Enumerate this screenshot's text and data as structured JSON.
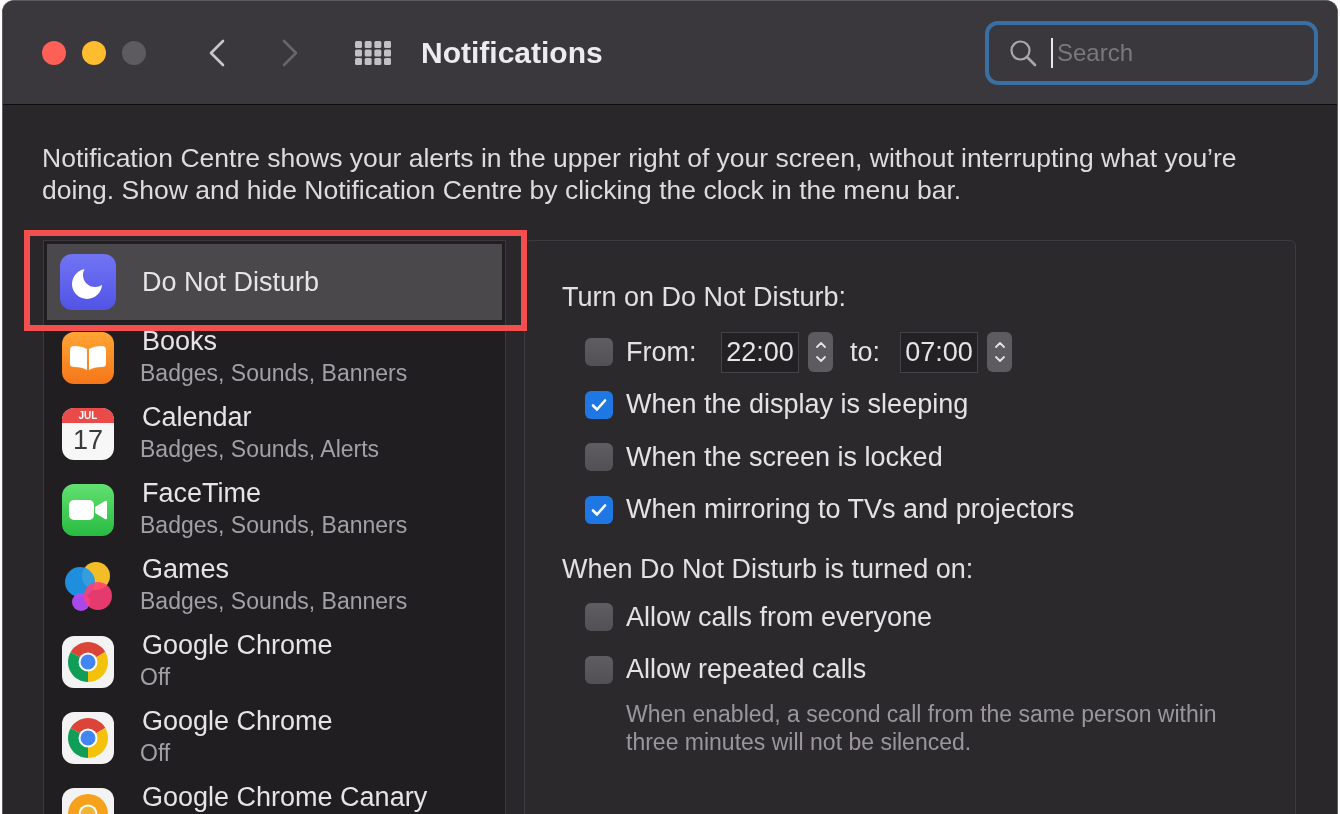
{
  "window": {
    "title": "Notifications",
    "buttons": [
      {
        "kind": "close",
        "disabled": false
      },
      {
        "kind": "minimize",
        "disabled": false
      },
      {
        "kind": "zoom",
        "disabled": true
      }
    ]
  },
  "nav": {
    "back": {
      "disabled": false
    },
    "forward": {
      "disabled": true
    }
  },
  "search": {
    "placeholder": "Search",
    "focused": true
  },
  "description": "Notification Centre shows your alerts in the upper right of your screen, without interrupting what you’re doing. Show and hide Notification Centre by clicking the clock in the menu bar.",
  "sidebar": {
    "items": [
      {
        "kind": "dnd",
        "name": "Do Not Disturb",
        "selected": true,
        "highlighted": true
      },
      {
        "kind": "books",
        "name": "Books",
        "detail": "Badges, Sounds, Banners",
        "selected": false,
        "highlighted": false
      },
      {
        "kind": "calendar",
        "name": "Calendar",
        "detail": "Badges, Sounds, Alerts",
        "icon_month": "JUL",
        "icon_day": "17",
        "selected": false,
        "highlighted": false
      },
      {
        "kind": "facetime",
        "name": "FaceTime",
        "detail": "Badges, Sounds, Banners",
        "selected": false,
        "highlighted": false
      },
      {
        "kind": "games",
        "name": "Games",
        "detail": "Badges, Sounds, Banners",
        "selected": false,
        "highlighted": false
      },
      {
        "kind": "chrome",
        "name": "Google Chrome",
        "detail": "Off",
        "selected": false,
        "highlighted": false
      },
      {
        "kind": "chrome",
        "name": "Google Chrome",
        "detail": "Off",
        "selected": false,
        "highlighted": false
      },
      {
        "kind": "canary",
        "name": "Google Chrome Canary",
        "selected": false,
        "highlighted": false
      }
    ]
  },
  "schedule": {
    "heading": "Turn on Do Not Disturb:",
    "options": [
      {
        "kind": "time_range",
        "label": "From:",
        "checked": false,
        "from": "22:00",
        "to_label": "to:",
        "to": "07:00"
      },
      {
        "kind": "check",
        "label": "When the display is sleeping",
        "checked": true
      },
      {
        "kind": "check",
        "label": "When the screen is locked",
        "checked": false
      },
      {
        "kind": "check",
        "label": "When mirroring to TVs and projectors",
        "checked": true
      }
    ]
  },
  "when_on": {
    "heading": "When Do Not Disturb is turned on:",
    "options": [
      {
        "kind": "check",
        "label": "Allow calls from everyone",
        "checked": false
      },
      {
        "kind": "check",
        "label": "Allow repeated calls",
        "checked": false,
        "note": "When enabled, a second call from the same person within three minutes will not be silenced."
      }
    ]
  }
}
